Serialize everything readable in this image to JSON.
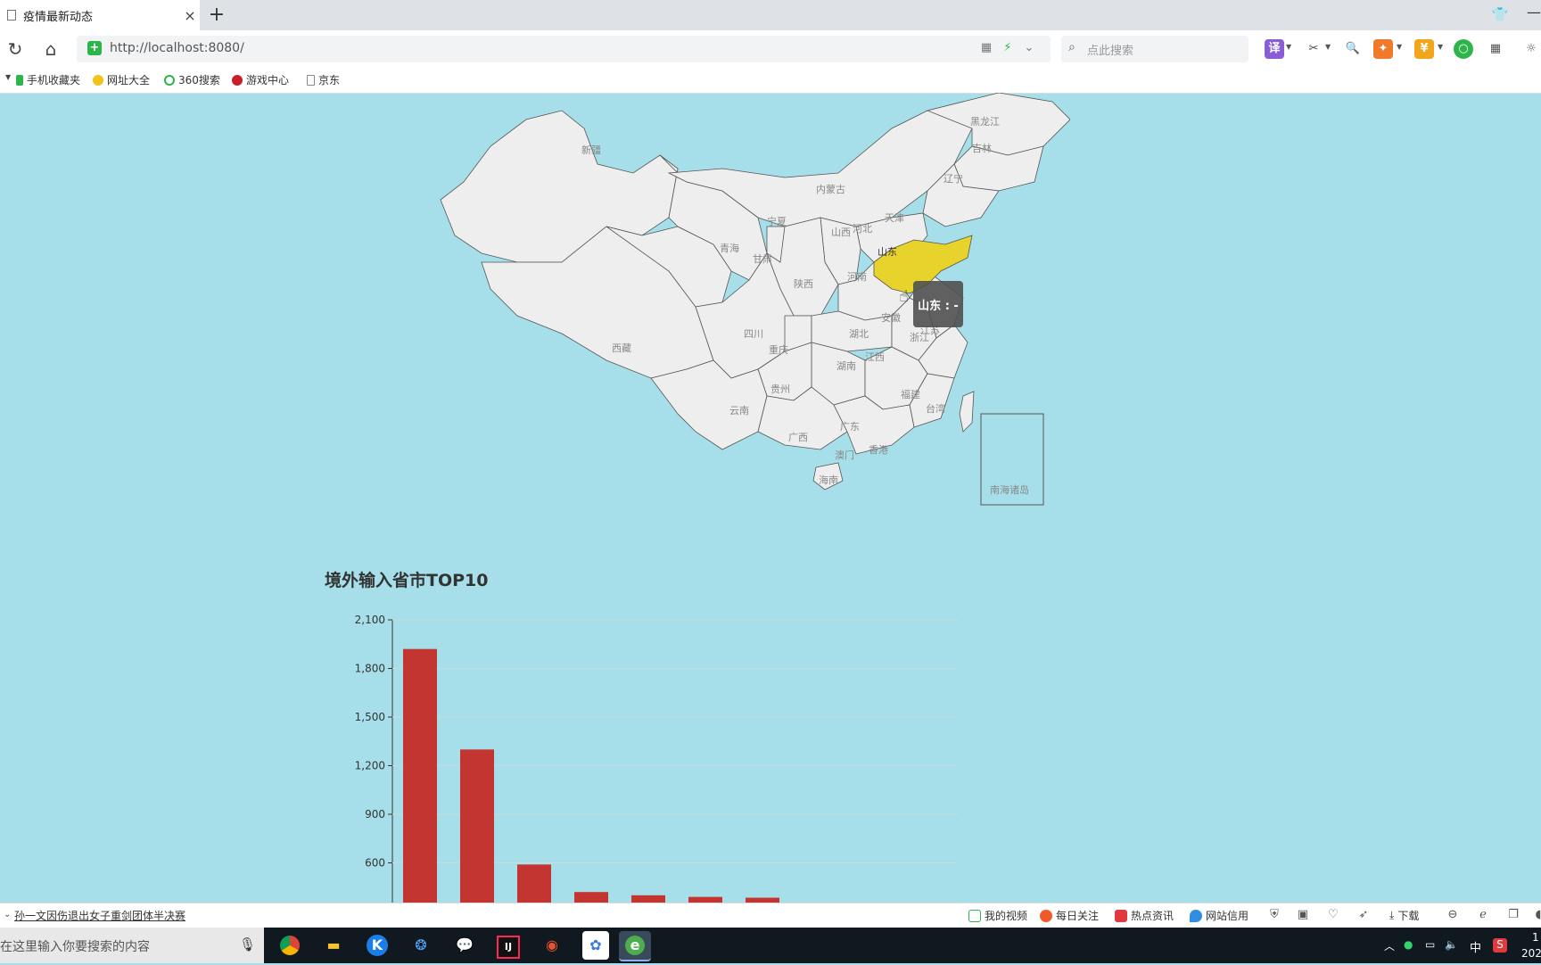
{
  "browser": {
    "tab_title": "疫情最新动态",
    "tab_close": "×",
    "new_tab": "+",
    "url": "http://localhost:8080/",
    "search_placeholder": "点此搜索",
    "bookmarks": [
      "手机收藏夹",
      "网址大全",
      "360搜索",
      "游戏中心",
      "京东"
    ],
    "toolbar_translate": "译"
  },
  "map": {
    "provinces": {
      "xinjiang": "新疆",
      "xizang": "西藏",
      "qinghai": "青海",
      "gansu": "甘肃",
      "neimenggu": "内蒙古",
      "heilongjiang": "黑龙江",
      "jilin": "吉林",
      "liaoning": "辽宁",
      "ningxia": "宁夏",
      "shanxi": "山西",
      "hebei": "河北",
      "tianjin": "天津",
      "shandong": "山东",
      "henan": "河南",
      "shaanxi": "陕西",
      "sichuan": "四川",
      "chongqing": "重庆",
      "hubei": "湖北",
      "anhui": "安徽",
      "jiangsu": "江苏",
      "zhejiang": "浙江",
      "hunan": "湖南",
      "jiangxi": "江西",
      "guizhou": "贵州",
      "yunnan": "云南",
      "guangxi": "广西",
      "guangdong": "广东",
      "fujian": "福建",
      "taiwan": "台湾",
      "hongkong": "香港",
      "macao": "澳门",
      "hainan": "海南",
      "nanhai": "南海诸岛"
    },
    "highlighted": "山东",
    "highlight_color": "#e8d22c",
    "tooltip": "山东 : -"
  },
  "chart_data": {
    "type": "bar",
    "title": "境外输入省市TOP10",
    "ylim": [
      0,
      2100
    ],
    "yticks": [
      "2,100",
      "1,800",
      "1,500",
      "1,200",
      "900",
      "600"
    ],
    "values": [
      1920,
      1300,
      590,
      420,
      400,
      390,
      385
    ],
    "bar_color": "#c23531",
    "grid": true
  },
  "statusbar": {
    "news": "孙一文因伤退出女子重剑团体半决赛",
    "items": [
      "我的视频",
      "每日关注",
      "热点资讯",
      "网站信用",
      "下载"
    ]
  },
  "taskbar": {
    "search_placeholder": "在这里输入你要搜索的内容",
    "ime": "中",
    "time_partial": "1",
    "date_partial": "202"
  }
}
